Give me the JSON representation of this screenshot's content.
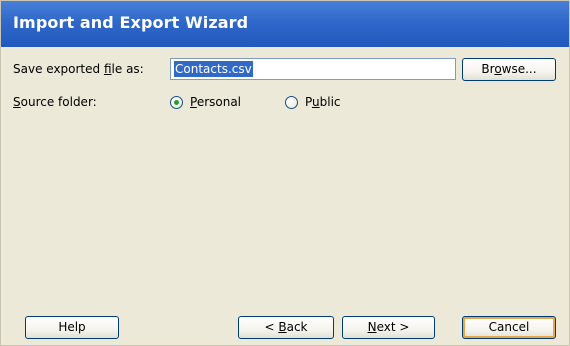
{
  "window": {
    "title": "Import and Export Wizard"
  },
  "save_file": {
    "label_prefix": "Save exported ",
    "label_mnemonic": "f",
    "label_suffix": "ile as:",
    "value": "Contacts.csv"
  },
  "browse_button": {
    "pre": "Br",
    "mnemonic": "o",
    "post": "wse..."
  },
  "source_folder": {
    "label_mnemonic": "S",
    "label_rest": "ource folder:",
    "options": [
      {
        "mnemonic": "P",
        "rest": "ersonal",
        "selected": true
      },
      {
        "pre": "P",
        "mnemonic": "u",
        "rest": "blic",
        "selected": false
      }
    ]
  },
  "buttons": {
    "help": "Help",
    "back_pre": "< ",
    "back_mnemonic": "B",
    "back_rest": "ack",
    "next_mnemonic": "N",
    "next_rest": "ext >",
    "cancel": "Cancel"
  }
}
